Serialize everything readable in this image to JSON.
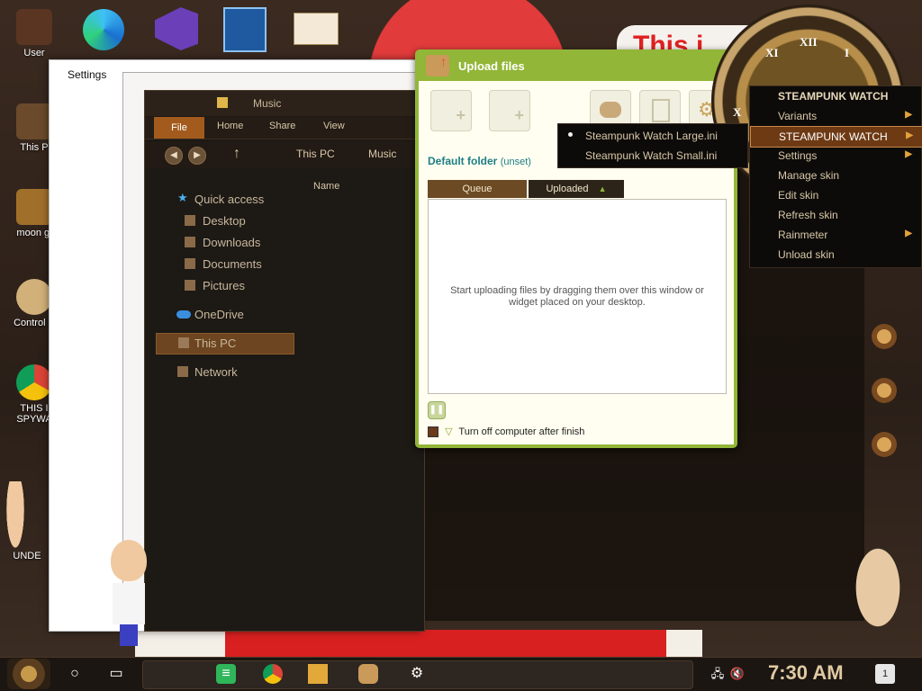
{
  "desktop": {
    "icons": [
      {
        "label": "User"
      },
      {
        "label": "This P"
      },
      {
        "label": "moon gi"
      },
      {
        "label": "Control P"
      },
      {
        "label": "THIS I SPYWA"
      },
      {
        "label": "UNDE"
      }
    ],
    "banner_text": "This i"
  },
  "settings_window": {
    "title": "Settings"
  },
  "explorer": {
    "title": "Music",
    "ribbon": {
      "file": "File",
      "home": "Home",
      "share": "Share",
      "view": "View"
    },
    "address": {
      "this_pc": "This PC",
      "music": "Music"
    },
    "column_name": "Name",
    "nav": {
      "quick_access": "Quick access",
      "desktop": "Desktop",
      "downloads": "Downloads",
      "documents": "Documents",
      "pictures": "Pictures",
      "onedrive": "OneDrive",
      "this_pc": "This PC",
      "network": "Network"
    }
  },
  "upload": {
    "title": "Upload files",
    "default_folder_label": "Default folder",
    "default_folder_value": "(unset)",
    "tab_queue": "Queue",
    "tab_uploaded": "Uploaded",
    "empty_message": "Start uploading files by dragging them over this window or widget placed on your desktop.",
    "shutdown_label": "Turn off computer after finish"
  },
  "variants_submenu": {
    "items": [
      "Steampunk Watch Large.ini",
      "Steampunk Watch Small.ini"
    ]
  },
  "context_menu": {
    "header": "STEAMPUNK WATCH",
    "variants": "Variants",
    "active_skin": "STEAMPUNK WATCH",
    "settings": "Settings",
    "manage_skin": "Manage skin",
    "edit_skin": "Edit skin",
    "refresh_skin": "Refresh skin",
    "rainmeter": "Rainmeter",
    "unload_skin": "Unload skin"
  },
  "clock": {
    "numerals": [
      "XII",
      "I",
      "XI",
      "X"
    ]
  },
  "taskbar": {
    "time": "7:30 AM",
    "notifications_count": "1"
  },
  "colors": {
    "upload_header": "#92b637",
    "menu_highlight": "#6d3a14",
    "accent_brown": "#a35b1d"
  }
}
